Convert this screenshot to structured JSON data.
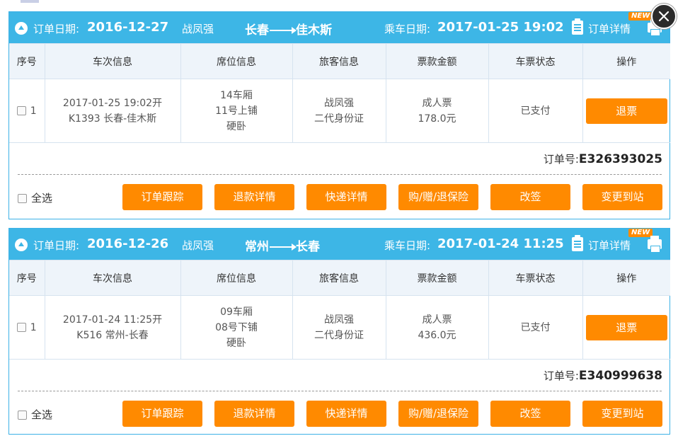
{
  "header_labels": {
    "order_date": "订单日期:",
    "ride_date": "乘车日期:",
    "order_detail": "订单详情",
    "new_badge": "NEW"
  },
  "columns": [
    "序号",
    "车次信息",
    "席位信息",
    "旅客信息",
    "票款金额",
    "车票状态",
    "操作"
  ],
  "footer_labels": {
    "order_no": "订单号:",
    "select_all": "全选"
  },
  "actions": [
    "订单跟踪",
    "退款详情",
    "快递详情",
    "购/赠/退保险",
    "改签",
    "变更到站"
  ],
  "orders": [
    {
      "order_date": "2016-12-27",
      "passenger": "战凤强",
      "from": "长春",
      "to": "佳木斯",
      "ride_date": "2017-01-25 19:02",
      "order_no": "E326393025",
      "row": {
        "index": "1",
        "train_line1": "2017-01-25 19:02开",
        "train_line2": "K1393 长春-佳木斯",
        "seat_line1": "14车厢",
        "seat_line2": "11号上铺",
        "seat_line3": "硬卧",
        "pass_line1": "战凤强",
        "pass_line2": "二代身份证",
        "price_line1": "成人票",
        "price_line2": "178.0元",
        "status": "已支付",
        "op": "退票"
      }
    },
    {
      "order_date": "2016-12-26",
      "passenger": "战凤强",
      "from": "常州",
      "to": "长春",
      "ride_date": "2017-01-24 11:25",
      "order_no": "E340999638",
      "row": {
        "index": "1",
        "train_line1": "2017-01-24 11:25开",
        "train_line2": "K516 常州-长春",
        "seat_line1": "09车厢",
        "seat_line2": "08号下铺",
        "seat_line3": "硬卧",
        "pass_line1": "战凤强",
        "pass_line2": "二代身份证",
        "price_line1": "成人票",
        "price_line2": "436.0元",
        "status": "已支付",
        "op": "退票"
      }
    }
  ],
  "colors": {
    "header_blue": "#3db6e6",
    "button_orange": "#ff8a00",
    "table_header_bg": "#eef4fa"
  }
}
